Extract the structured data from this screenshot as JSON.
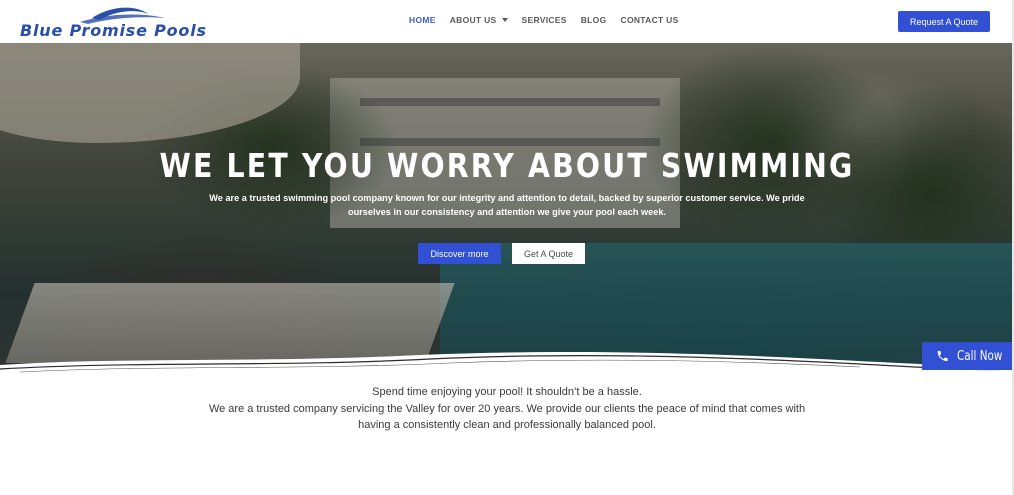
{
  "brand": {
    "name": "Blue Promise Pools",
    "color": "#2a4fa8"
  },
  "nav": {
    "items": [
      {
        "label": "HOME",
        "active": true
      },
      {
        "label": "ABOUT US",
        "has_dropdown": true
      },
      {
        "label": "SERVICES"
      },
      {
        "label": "BLOG"
      },
      {
        "label": "CONTACT US"
      }
    ],
    "cta_label": "Request A Quote"
  },
  "hero": {
    "title": "WE LET YOU WORRY ABOUT SWIMMING",
    "subtitle": "We are a trusted swimming pool company known for our integrity and attention to detail, backed by superior customer service. We pride ourselves in our consistency and attention we give your pool each week.",
    "primary_button": "Discover more",
    "secondary_button": "Get A Quote"
  },
  "call_now": {
    "label": "Call Now",
    "icon": "phone-icon"
  },
  "intro": {
    "line1": "Spend time enjoying your pool!  It shouldn’t be a hassle.",
    "line2": "We are a trusted company servicing the Valley for over 20 years. We provide our clients the peace of mind that comes with having a consistently clean and professionally balanced pool."
  },
  "colors": {
    "accent": "#3150d4",
    "nav_active": "#3b5fc4",
    "text": "#3a3a3a"
  }
}
